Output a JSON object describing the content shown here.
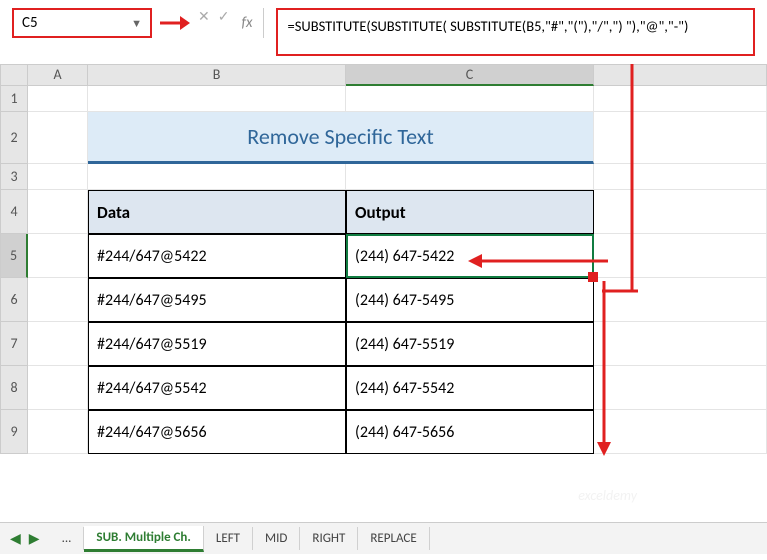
{
  "name_box": "C5",
  "formula": "=SUBSTITUTE(SUBSTITUTE( SUBSTITUTE(B5,\"#\",\"(\"),\"/\",\") \"),\"@\",\"-\")",
  "fx_label": "fx",
  "columns": [
    "A",
    "B",
    "C"
  ],
  "row_numbers": [
    "1",
    "2",
    "3",
    "4",
    "5",
    "6",
    "7",
    "8",
    "9"
  ],
  "title": "Remove Specific Text",
  "headers": {
    "data": "Data",
    "output": "Output"
  },
  "rows": [
    {
      "data": "#244/647@5422",
      "output": "(244) 647-5422"
    },
    {
      "data": "#244/647@5495",
      "output": "(244) 647-5495"
    },
    {
      "data": "#244/647@5519",
      "output": "(244) 647-5519"
    },
    {
      "data": "#244/647@5542",
      "output": "(244) 647-5542"
    },
    {
      "data": "#244/647@5656",
      "output": "(244) 647-5656"
    }
  ],
  "tabs": {
    "ellipsis": "...",
    "active": "SUB. Multiple Ch.",
    "others": [
      "LEFT",
      "MID",
      "RIGHT",
      "REPLACE"
    ]
  },
  "watermark": "exceldemy"
}
